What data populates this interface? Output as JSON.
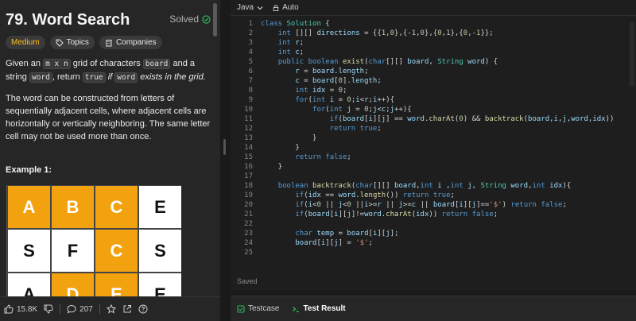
{
  "problem": {
    "title": "79. Word Search",
    "status": "Solved",
    "tags": [
      "Medium",
      "Topics",
      "Companies"
    ],
    "desc": {
      "p1_a": "Given an ",
      "p1_code1": "m x n",
      "p1_b": " grid of characters ",
      "p1_code2": "board",
      "p1_c": " and a string ",
      "p1_code3": "word",
      "p1_d": ", return ",
      "p1_code4": "true",
      "p1_e": " if ",
      "p1_code5": "word",
      "p1_f": " exists in the grid.",
      "p2": "The word can be constructed from letters of sequentially adjacent cells, where adjacent cells are horizontally or vertically neighboring. The same letter cell may not be used more than once."
    },
    "example_title": "Example 1:",
    "grid": [
      [
        "A",
        "B",
        "C",
        "E"
      ],
      [
        "S",
        "F",
        "C",
        "S"
      ],
      [
        "A",
        "D",
        "E",
        "E"
      ]
    ],
    "highlight": [
      [
        1,
        1,
        1,
        0
      ],
      [
        0,
        0,
        1,
        0
      ],
      [
        0,
        1,
        1,
        0
      ]
    ]
  },
  "footer": {
    "likes": "15.8K",
    "comments": "207"
  },
  "editor": {
    "language": "Java",
    "mode": "Auto",
    "saved": "Saved"
  },
  "bottom_tabs": [
    "Testcase",
    "Test Result"
  ]
}
